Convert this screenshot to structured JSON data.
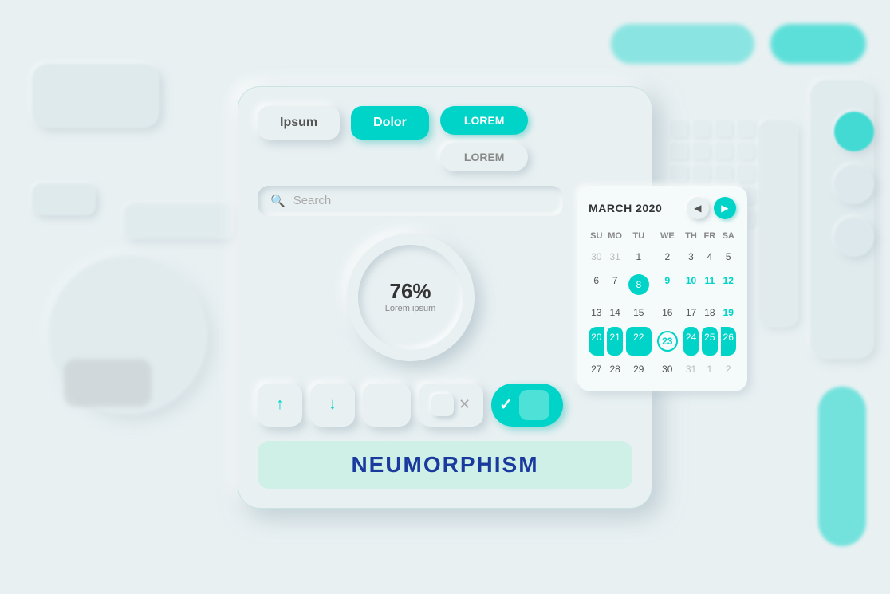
{
  "background": {
    "color": "#e8f0f2"
  },
  "buttons": {
    "ipsum_label": "Ipsum",
    "dolor_label": "Dolor",
    "lorem_teal_label": "LOREM",
    "lorem_outline_label": "LOREM"
  },
  "search": {
    "placeholder": "Search"
  },
  "progress": {
    "percent": "76%",
    "sub": "Lorem ipsum",
    "value": 76,
    "radius": 52,
    "circumference": 326.7
  },
  "calendar": {
    "title": "MARCH 2020",
    "day_headers": [
      "SU",
      "MO",
      "TU",
      "WE",
      "TH",
      "FR",
      "SA"
    ],
    "weeks": [
      [
        "30",
        "31",
        "1",
        "2",
        "3",
        "4",
        "5"
      ],
      [
        "6",
        "7",
        "8",
        "9",
        "10",
        "11",
        "12"
      ],
      [
        "13",
        "14",
        "15",
        "16",
        "17",
        "18",
        "19"
      ],
      [
        "20",
        "21",
        "22",
        "23",
        "24",
        "25",
        "26"
      ],
      [
        "27",
        "28",
        "29",
        "30",
        "31",
        "1",
        "2"
      ]
    ],
    "day_styles": {
      "week0": [
        "other",
        "other",
        "",
        "",
        "",
        "",
        ""
      ],
      "week1": [
        "",
        "",
        "teal-bg",
        "",
        "teal-text",
        "teal-text",
        "teal-text"
      ],
      "week2": [
        "",
        "",
        "",
        "",
        "",
        "",
        "teal-text"
      ],
      "week3": [
        "row-teal-first",
        "row-teal",
        "row-teal",
        "teal-outline",
        "row-teal",
        "row-teal",
        "row-teal-last"
      ],
      "week4": [
        "",
        "",
        "",
        "",
        "other",
        "other",
        "other"
      ]
    }
  },
  "title": {
    "text": "NEUMORPHISM"
  },
  "icons": {
    "search": "🔍",
    "up_arrow": "↑",
    "down_arrow": "↓",
    "close_x": "✕",
    "check": "✓",
    "prev": "◀",
    "next": "▶"
  }
}
